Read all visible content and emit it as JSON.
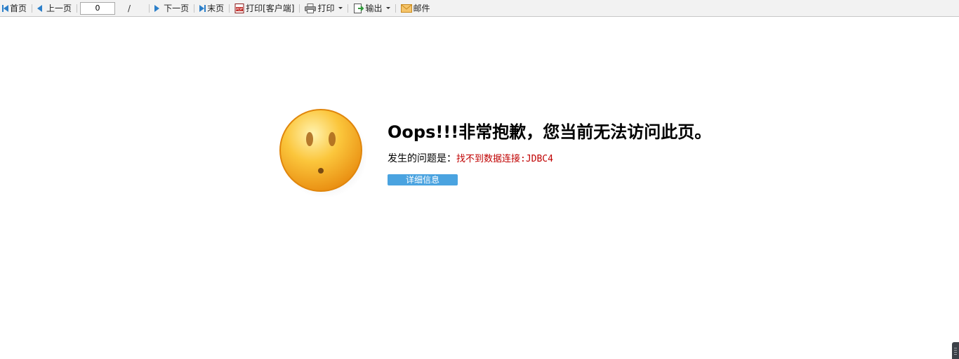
{
  "toolbar": {
    "first_page": "首页",
    "prev_page": "上一页",
    "page_number_value": "0",
    "page_separator": "/",
    "next_page": "下一页",
    "last_page": "末页",
    "print_client": "打印[客户端]",
    "print": "打印",
    "export": "输出",
    "mail": "邮件",
    "icon_names": [
      "first-page-icon",
      "prev-page-icon",
      "next-page-icon",
      "last-page-icon",
      "pdf-print-icon",
      "printer-icon",
      "export-icon",
      "mail-icon"
    ]
  },
  "error": {
    "title": "Oops!!!非常抱歉，您当前无法访问此页。",
    "problem_label": "发生的问题是：",
    "problem_detail": "找不到数据连接:JDBC4",
    "details_button": "详细信息"
  },
  "colors": {
    "toolbar_bg": "#f2f2f2",
    "nav_icon": "#2c7fc9",
    "error_text": "#c00000",
    "button_bg": "#4aa3e0",
    "face_orange": "#f7a21b"
  }
}
